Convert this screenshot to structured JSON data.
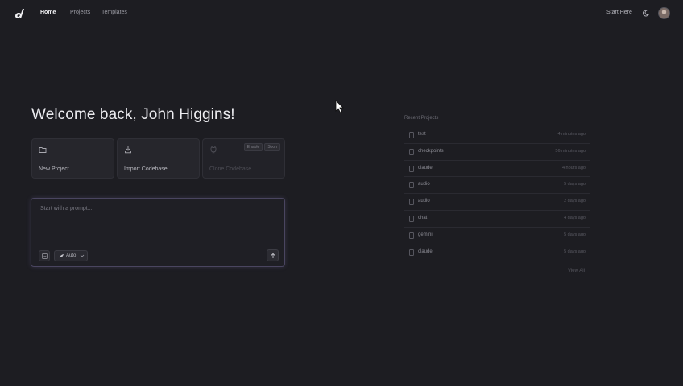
{
  "nav": {
    "links": [
      {
        "label": "Home",
        "active": true
      },
      {
        "label": "Projects",
        "active": false
      },
      {
        "label": "Templates",
        "active": false
      }
    ],
    "start_here": "Start Here",
    "icons": {
      "logo": "brand-logo-icon",
      "theme": "moon-icon",
      "avatar": "user-avatar"
    }
  },
  "welcome": {
    "title": "Welcome back, John Higgins!"
  },
  "actions": [
    {
      "label": "New Project",
      "icon": "folder-icon",
      "enabled": true
    },
    {
      "label": "Import Codebase",
      "icon": "download-icon",
      "enabled": true
    },
    {
      "label": "Clone Codebase",
      "icon": "github-icon",
      "enabled": false,
      "badges": [
        "Enable",
        "Soon"
      ]
    }
  ],
  "prompt": {
    "placeholder": "Start with a prompt...",
    "model_label": "Auto",
    "icons": {
      "attach": "attach-icon",
      "model": "model-icon",
      "send": "arrow-up-icon"
    }
  },
  "recent": {
    "title": "Recent Projects",
    "projects": [
      {
        "name": "test",
        "time": "4 minutes ago"
      },
      {
        "name": "checkpoints",
        "time": "56 minutes ago"
      },
      {
        "name": "claude",
        "time": "4 hours ago"
      },
      {
        "name": "audio",
        "time": "5 days ago"
      },
      {
        "name": "audio",
        "time": "2 days ago"
      },
      {
        "name": "chat",
        "time": "4 days ago"
      },
      {
        "name": "gemini",
        "time": "5 days ago"
      },
      {
        "name": "claude",
        "time": "5 days ago"
      }
    ],
    "view_all": "View All"
  },
  "colors": {
    "background": "#1d1d22",
    "card": "#26262c",
    "accent_border": "#4a4560"
  }
}
